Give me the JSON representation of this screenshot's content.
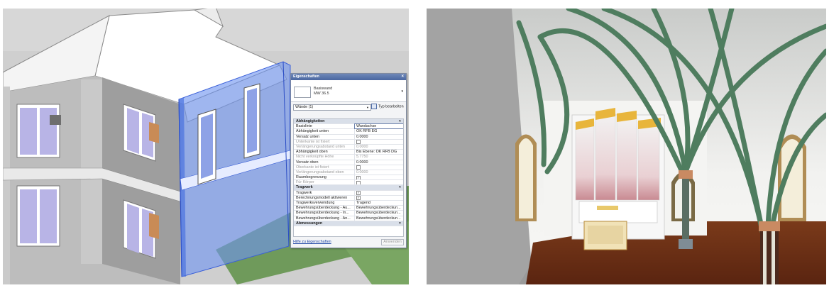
{
  "properties_panel": {
    "title": "Eigenschaften",
    "close": "×",
    "type_name_line1": "Basiswand",
    "type_name_line2": "MW 36.5",
    "selector_value": "Wände (1)",
    "edit_type_label": "Typ bearbeiten",
    "rows": [
      {
        "kind": "header",
        "label": "Abhängigkeiten",
        "value": "≈"
      },
      {
        "label": "Basislinie",
        "value": "Wandachse",
        "highlight": true
      },
      {
        "label": "Abhängigkeit unten",
        "value": "OK RFB EG"
      },
      {
        "label": "Versatz unten",
        "value": "0.0000"
      },
      {
        "label": "Unterkante ist fixiert",
        "value": "",
        "check": "off",
        "dim": true
      },
      {
        "label": "Verlängerungsabstand unten",
        "value": "0.0000",
        "dim": true
      },
      {
        "label": "Abhängigkeit oben",
        "value": "Bis Ebene: OK RFB DG"
      },
      {
        "label": "Nicht verknüpfte Höhe",
        "value": "5.7750",
        "dim": true
      },
      {
        "label": "Versatz oben",
        "value": "0.0000"
      },
      {
        "label": "Oberkante ist fixiert",
        "value": "",
        "check": "off",
        "dim": true
      },
      {
        "label": "Verlängerungsabstand oben",
        "value": "0.0000",
        "dim": true
      },
      {
        "label": "Raumbegrenzung",
        "value": "",
        "check": "on"
      },
      {
        "label": "Für Körper",
        "value": "",
        "check": "off",
        "dim": true
      },
      {
        "kind": "header",
        "label": "Tragwerk",
        "value": "≈"
      },
      {
        "label": "Tragwerk",
        "value": "",
        "check": "on"
      },
      {
        "label": "Berechnungsmodell aktivieren",
        "value": "",
        "check": "on"
      },
      {
        "label": "Tragwerksverwendung",
        "value": "Tragend"
      },
      {
        "label": "Bewehrungsüberdeckung - Au...",
        "value": "Bewehrungsüberdeckun..."
      },
      {
        "label": "Bewehrungsüberdeckung - In...",
        "value": "Bewehrungsüberdeckun..."
      },
      {
        "label": "Bewehrungsüberdeckung - An...",
        "value": "Bewehrungsüberdeckun..."
      },
      {
        "kind": "header",
        "label": "Abmessungen",
        "value": "≈"
      }
    ],
    "help_link": "Hilfe zu Eigenschaften",
    "apply_button": "Anwenden"
  },
  "colors": {
    "selection_blue": "#6f95f0",
    "rib_green": "#4f7d5f",
    "floor_brown": "#6b2d14",
    "organ_gold": "#e8b53c",
    "grass": "#6f9a5b"
  }
}
